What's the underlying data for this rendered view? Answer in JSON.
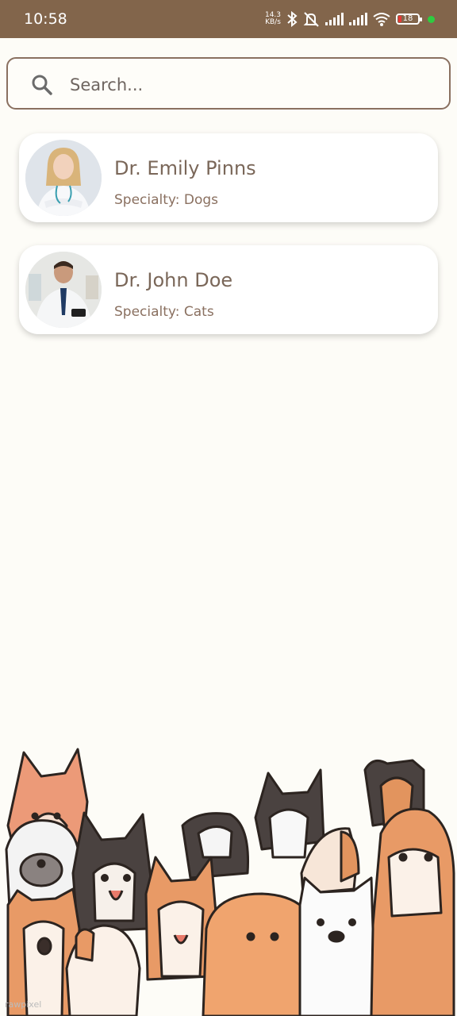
{
  "status_bar": {
    "time": "10:58",
    "net_speed_value": "14.3",
    "net_speed_unit": "KB/s",
    "battery_level": "18",
    "icons": [
      "bluetooth-icon",
      "mute-icon",
      "signal-icon",
      "signal-icon",
      "wifi-icon",
      "battery-icon"
    ],
    "background_color": "#82654b"
  },
  "search": {
    "placeholder": "Search..."
  },
  "doctors": [
    {
      "name": "Dr. Emily Pinns",
      "specialty": "Specialty: Dogs"
    },
    {
      "name": "Dr. John Doe",
      "specialty": "Specialty: Cats"
    }
  ],
  "watermark": "rawpixel",
  "colors": {
    "accent": "#82654b",
    "text_primary": "#7a6759",
    "background": "#fdfcf7"
  }
}
